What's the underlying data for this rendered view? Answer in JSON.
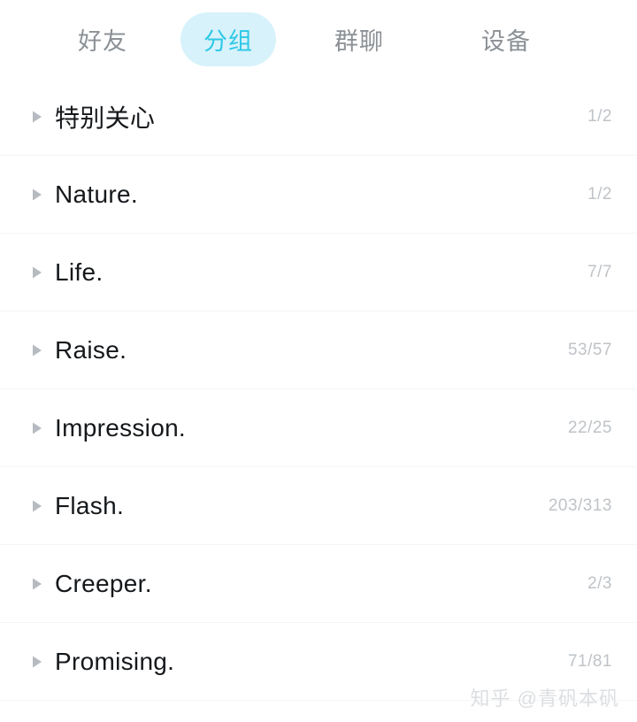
{
  "theme": {
    "background": "#ffffff",
    "accent": "#2ec8e6",
    "accent_pill_bg": "#d7f2fb",
    "tab_inactive_color": "#8c9196",
    "label_color": "#15181b",
    "count_color": "#bfc3c7",
    "divider_color": "#f4f5f6",
    "expander_color": "#b6bbc1",
    "watermark_color": "#dcdfe2"
  },
  "tabbar": {
    "tabs": [
      {
        "label": "好友",
        "active": false
      },
      {
        "label": "分组",
        "active": true
      },
      {
        "label": "群聊",
        "active": false
      },
      {
        "label": "设备",
        "active": false
      }
    ]
  },
  "group_list": {
    "expander_icon": "triangle-right-icon",
    "rows": [
      {
        "label": "特别关心",
        "count": "1/2",
        "online": 1,
        "total": 2
      },
      {
        "label": "Nature.",
        "count": "1/2",
        "online": 1,
        "total": 2
      },
      {
        "label": "Life.",
        "count": "7/7",
        "online": 7,
        "total": 7
      },
      {
        "label": "Raise.",
        "count": "53/57",
        "online": 53,
        "total": 57
      },
      {
        "label": "Impression.",
        "count": "22/25",
        "online": 22,
        "total": 25
      },
      {
        "label": "Flash.",
        "count": "203/313",
        "online": 203,
        "total": 313
      },
      {
        "label": "Creeper.",
        "count": "2/3",
        "online": 2,
        "total": 3
      },
      {
        "label": "Promising.",
        "count": "71/81",
        "online": 71,
        "total": 81
      }
    ]
  },
  "watermark": {
    "text": "知乎 @青矾本矾"
  }
}
